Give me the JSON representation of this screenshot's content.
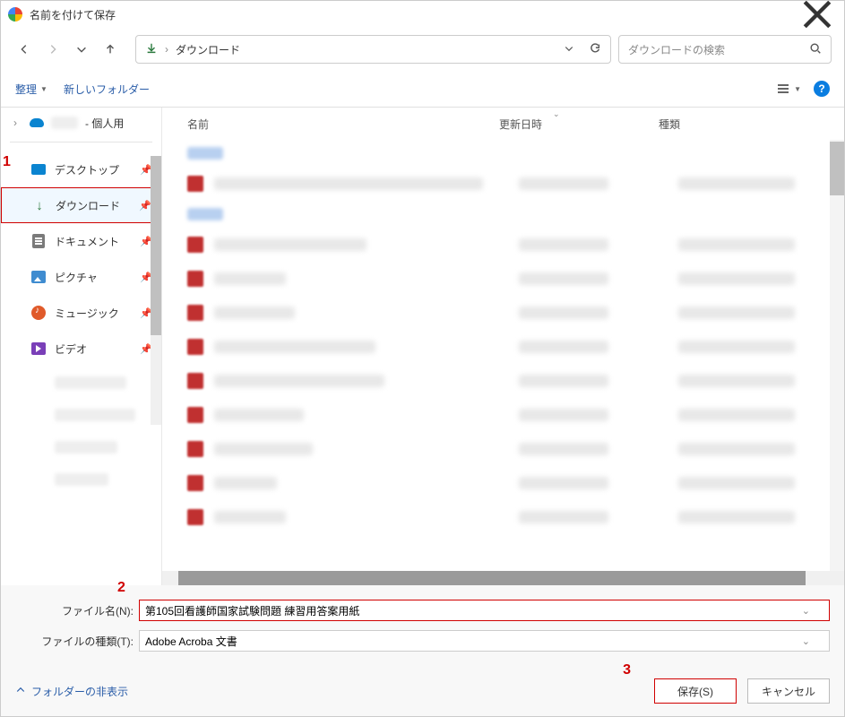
{
  "title": "名前を付けて保存",
  "address": {
    "current_folder": "ダウンロード",
    "separator": "›"
  },
  "search": {
    "placeholder": "ダウンロードの検索"
  },
  "toolbar": {
    "organize": "整理",
    "new_folder": "新しいフォルダー"
  },
  "tree": {
    "onedrive_suffix": " - 個人用"
  },
  "quick_access": [
    {
      "icon": "desktop",
      "label": "デスクトップ"
    },
    {
      "icon": "download",
      "label": "ダウンロード",
      "highlight": true
    },
    {
      "icon": "doc",
      "label": "ドキュメント"
    },
    {
      "icon": "pic",
      "label": "ピクチャ"
    },
    {
      "icon": "music",
      "label": "ミュージック"
    },
    {
      "icon": "video",
      "label": "ビデオ"
    }
  ],
  "columns": {
    "name": "名前",
    "date": "更新日時",
    "type": "種類"
  },
  "form": {
    "filename_label": "ファイル名(N):",
    "filetype_label": "ファイルの種類(T):",
    "filename_value": "第105回看護師国家試験問題 練習用答案用紙",
    "filetype_value": "Adobe Acroba 文書"
  },
  "pane_toggle": "フォルダーの非表示",
  "buttons": {
    "save": "保存(S)",
    "cancel": "キャンセル"
  },
  "annotations": {
    "a1": "1",
    "a2": "2",
    "a3": "3"
  },
  "help_glyph": "?"
}
